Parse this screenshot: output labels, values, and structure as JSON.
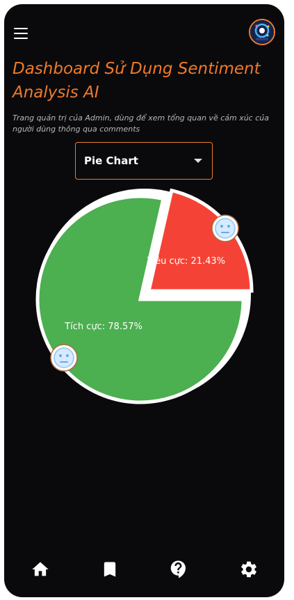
{
  "header": {
    "menu_icon": "menu-icon",
    "avatar_icon": "avatar-logo"
  },
  "page": {
    "title": "Dashboard Sử Dụng Sentiment Analysis AI",
    "subtitle": "Trang quản trị của Admin, dùng để xem tổng quan về cảm xúc của người dùng thông qua comments"
  },
  "chart_select": {
    "selected": "Pie Chart"
  },
  "chart_data": {
    "type": "pie",
    "slices": [
      {
        "label": "Tiêu cực: 21.43%",
        "value": 21.43,
        "color": "#f44336"
      },
      {
        "label": "Tích cực: 78.57%",
        "value": 78.57,
        "color": "#4caf50"
      }
    ],
    "badge_icon": "neutral-face-icon"
  },
  "bottom_nav": {
    "items": [
      {
        "icon": "home-icon"
      },
      {
        "icon": "bookmark-icon"
      },
      {
        "icon": "help-icon"
      },
      {
        "icon": "settings-icon"
      }
    ]
  }
}
